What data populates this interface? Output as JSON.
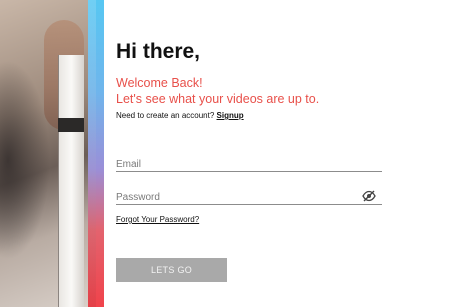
{
  "hero": {
    "image_description_icon": "person-holding-device-photo"
  },
  "accent": {
    "gradient_colors": [
      "#57c7f2",
      "#9a8fd8",
      "#f0434b"
    ]
  },
  "login": {
    "greeting": "Hi there,",
    "welcome_line1": "Welcome Back!",
    "welcome_line2": "Let's see what your videos are up to.",
    "signup_prompt": "Need to create an account? ",
    "signup_link": "Signup",
    "email_placeholder": "Email",
    "password_placeholder": "Password",
    "password_toggle_icon": "eye-slash-icon",
    "forgot_link": "Forgot Your Password?",
    "submit_label": "LETS GO"
  },
  "colors": {
    "welcome_text": "#e8504a",
    "button_bg": "#a9a9a9"
  }
}
